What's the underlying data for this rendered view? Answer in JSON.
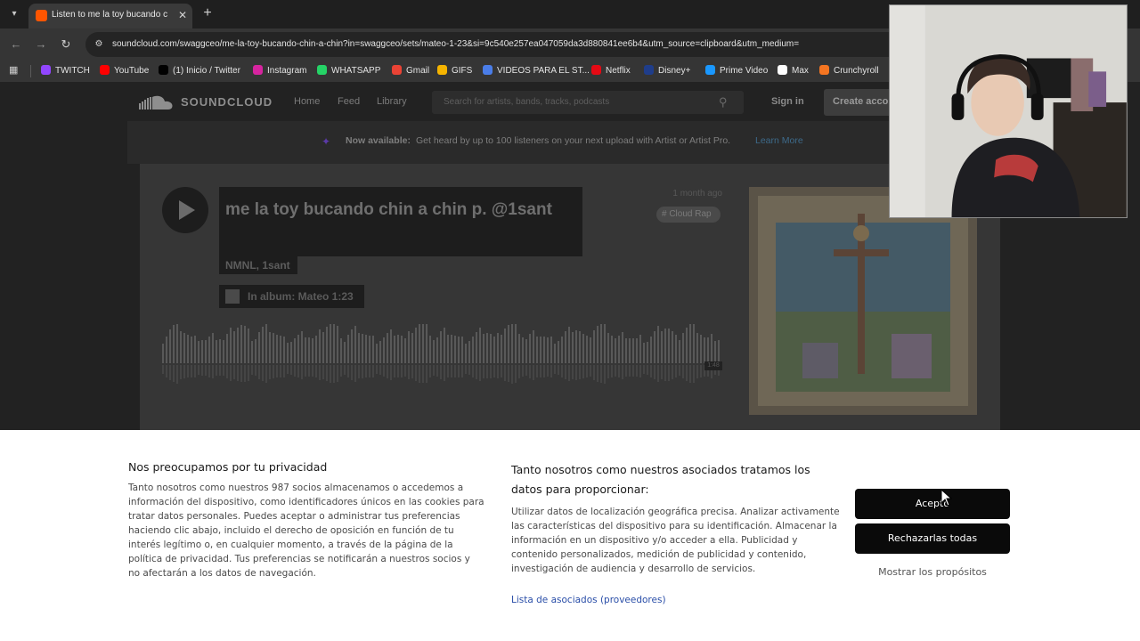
{
  "browser": {
    "tab_menu_icon": "chevron-down-icon",
    "active_tab_title": "Listen to me la toy bucando chin a chin",
    "tab_close": "✕",
    "new_tab": "+",
    "url": "soundcloud.com/swaggceo/me-la-toy-bucando-chin-a-chin?in=swaggceo/sets/mateo-1-23&si=9c540e257ea047059da3d880841ee6b4&utm_source=clipboard&utm_medium=",
    "bookmarks": [
      {
        "label": "TWITCH",
        "color": "#9146ff"
      },
      {
        "label": "YouTube",
        "color": "#ff0000"
      },
      {
        "label": "(1) Inicio / Twitter",
        "color": "#000000"
      },
      {
        "label": "Instagram",
        "color": "#d6249f"
      },
      {
        "label": "WHATSAPP",
        "color": "#25d366"
      },
      {
        "label": "Gmail",
        "color": "#ea4335"
      },
      {
        "label": "GIFS",
        "color": "#f5b400"
      },
      {
        "label": "VIDEOS PARA EL ST...",
        "color": "#4a7de8"
      },
      {
        "label": "Netflix",
        "color": "#e50914"
      },
      {
        "label": "Disney+",
        "color": "#1f3d8a"
      },
      {
        "label": "Prime Video",
        "color": "#1a98ff"
      },
      {
        "label": "Max",
        "color": "#ffffff"
      },
      {
        "label": "Crunchyroll",
        "color": "#f47521"
      }
    ]
  },
  "soundcloud": {
    "logo_text": "SOUNDCLOUD",
    "nav": [
      "Home",
      "Feed",
      "Library"
    ],
    "search_placeholder": "Search for artists, bands, tracks, podcasts",
    "sign_in": "Sign in",
    "create_account": "Create account",
    "promo_bold": "Now available:",
    "promo_text": "Get heard by up to 100 listeners on your next upload with Artist or Artist Pro.",
    "promo_link": "Learn More",
    "track_title": "me la toy bucando chin a chin p. @1sant",
    "artists": "NMNL, 1sant",
    "album": "In album: Mateo 1:23",
    "time_ago": "1 month ago",
    "genre": "# Cloud Rap",
    "duration": "1:48"
  },
  "consent": {
    "left_title": "Nos preocupamos por tu privacidad",
    "left_body": "Tanto nosotros como nuestros 987 socios almacenamos o accedemos a información del dispositivo, como identificadores únicos en las cookies para tratar datos personales. Puedes aceptar o administrar tus preferencias haciendo clic abajo, incluido el derecho de oposición en función de tu interés legítimo o, en cualquier momento, a través de la página de la política de privacidad. Tus preferencias se notificarán a nuestros socios y no afectarán a los datos de navegación.",
    "mid_title": "Tanto nosotros como nuestros asociados tratamos los datos para proporcionar:",
    "mid_body": "Utilizar datos de localización geográfica precisa. Analizar activamente las características del dispositivo para su identificación. Almacenar la información en un dispositivo y/o acceder a ella. Publicidad y contenido personalizados, medición de publicidad y contenido, investigación de audiencia y desarrollo de servicios.",
    "mid_link": "Lista de asociados (proveedores)",
    "accept": "Acepto",
    "reject": "Rechazarlas todas",
    "purposes": "Mostrar los propósitos"
  }
}
